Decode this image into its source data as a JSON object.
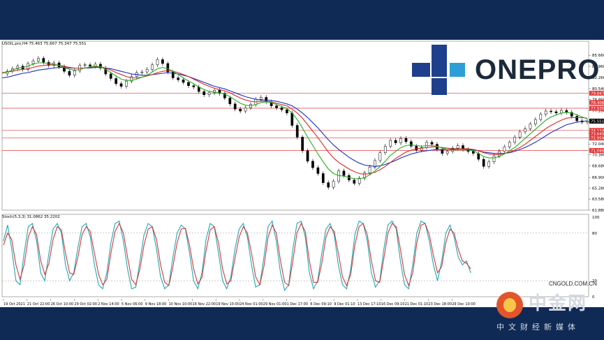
{
  "chart_data": [
    {
      "type": "line",
      "title": "USOIL.pro,H4 75.463 75.667 75.347 75.551",
      "ylim": [
        61.88,
        87.4
      ],
      "y_ticks": [
        "85.660",
        "83.960",
        "82.260",
        "80.540",
        "78.860",
        "77.160",
        "75.441",
        "73.740",
        "72.040",
        "70.380",
        "68.680",
        "66.900",
        "65.280",
        "63.580",
        "61.880"
      ],
      "price_labels": [
        {
          "text": "79.847",
          "value": 79.847,
          "color": "#e23b3b"
        },
        {
          "text": "78.406",
          "value": 78.406,
          "color": "#e23b3b"
        },
        {
          "text": "77.535",
          "value": 77.535,
          "color": "#e23b3b"
        },
        {
          "text": "75.551",
          "value": 75.551,
          "color": "#000000"
        },
        {
          "text": "74.124",
          "value": 74.124,
          "color": "#e23b3b"
        },
        {
          "text": "73.640",
          "value": 73.64,
          "color": "#e23b3b"
        },
        {
          "text": "72.959",
          "value": 72.959,
          "color": "#e23b3b"
        },
        {
          "text": "71.046",
          "value": 71.046,
          "color": "#e23b3b"
        }
      ],
      "h_lines": [
        79.847,
        77.535,
        74.124,
        72.959,
        71.046
      ],
      "x_labels": [
        "19 Oct 2021",
        "21 Oct 22:00",
        "26 Oct 10:00",
        "29 Oct 02:00",
        "2 Nov 14:00",
        "5 Nov 06:00",
        "9 Nov 18:00",
        "10 Nov 10:00",
        "16 Nov 22:00",
        "19 Nov 10:00",
        "24 Nov 01:00",
        "29 Nov 01:00",
        "1 Dec 17:00",
        "6 Dec 09:10",
        "9 Dec 01:10",
        "13 Dec 17:10",
        "16 Dec 09:10",
        "21 Dec 01:10",
        "23 Dec 18:00",
        "29 Dec 10:00"
      ],
      "close": [
        82.8,
        83.2,
        83.6,
        84.0,
        83.5,
        84.4,
        84.8,
        85.2,
        84.6,
        84.1,
        84.5,
        83.9,
        83.2,
        82.6,
        83.3,
        84.1,
        84.2,
        84.0,
        84.3,
        83.7,
        82.8,
        82.1,
        81.3,
        80.9,
        81.7,
        82.4,
        83.0,
        83.1,
        83.5,
        84.2,
        85.0,
        84.4,
        83.1,
        82.2,
        81.9,
        81.5,
        81.0,
        80.8,
        80.1,
        79.6,
        79.9,
        80.3,
        79.8,
        79.1,
        78.2,
        77.4,
        77.1,
        77.6,
        78.1,
        78.9,
        79.2,
        78.5,
        77.9,
        77.6,
        77.3,
        76.8,
        74.9,
        73.1,
        71.0,
        69.4,
        68.4,
        67.5,
        66.1,
        65.4,
        66.3,
        67.9,
        67.2,
        66.5,
        66.0,
        66.8,
        67.6,
        68.5,
        69.5,
        70.7,
        71.7,
        72.6,
        72.2,
        72.9,
        72.4,
        71.7,
        71.1,
        71.5,
        72.3,
        72.0,
        71.2,
        70.6,
        70.9,
        71.4,
        71.8,
        71.2,
        70.9,
        70.6,
        69.7,
        68.6,
        69.3,
        70.2,
        70.9,
        71.6,
        72.3,
        73.1,
        73.9,
        74.4,
        75.1,
        75.8,
        76.6,
        77.1,
        77.0,
        76.8,
        77.2,
        76.9,
        76.3,
        75.6,
        75.4,
        75.551
      ],
      "ma_green": [
        82.9,
        83.1,
        83.4,
        83.7,
        83.8,
        84.0,
        84.3,
        84.5,
        84.5,
        84.4,
        84.3,
        84.1,
        83.8,
        83.5,
        83.4,
        83.5,
        83.7,
        83.9,
        84.0,
        83.9,
        83.5,
        83.0,
        82.5,
        82.0,
        81.8,
        81.8,
        82.0,
        82.3,
        82.6,
        83.1,
        83.6,
        83.8,
        83.6,
        83.2,
        82.7,
        82.2,
        81.7,
        81.3,
        80.8,
        80.4,
        80.1,
        80.0,
        79.9,
        79.7,
        79.3,
        78.8,
        78.3,
        78.0,
        77.9,
        78.1,
        78.4,
        78.5,
        78.4,
        78.1,
        77.8,
        77.5,
        76.8,
        75.8,
        74.5,
        73.1,
        71.8,
        70.5,
        69.3,
        68.2,
        67.5,
        67.2,
        67.1,
        66.9,
        66.7,
        66.7,
        66.9,
        67.3,
        67.9,
        68.6,
        69.4,
        70.3,
        70.9,
        71.5,
        71.8,
        71.9,
        71.8,
        71.7,
        71.8,
        71.8,
        71.7,
        71.4,
        71.2,
        71.1,
        71.2,
        71.2,
        71.1,
        71.0,
        70.6,
        70.1,
        69.9,
        69.9,
        70.1,
        70.5,
        71.0,
        71.5,
        72.2,
        72.9,
        73.6,
        74.3,
        75.0,
        75.7,
        76.2,
        76.5,
        76.8,
        76.9,
        76.8,
        76.5,
        76.2,
        75.9
      ],
      "ma_red": [
        83.0,
        83.1,
        83.2,
        83.4,
        83.5,
        83.6,
        83.8,
        84.0,
        84.1,
        84.2,
        84.2,
        84.1,
        84.0,
        83.8,
        83.7,
        83.7,
        83.7,
        83.8,
        83.9,
        83.9,
        83.7,
        83.4,
        83.0,
        82.7,
        82.4,
        82.2,
        82.2,
        82.3,
        82.5,
        82.7,
        83.0,
        83.2,
        83.3,
        83.2,
        83.0,
        82.7,
        82.4,
        82.0,
        81.6,
        81.2,
        80.9,
        80.6,
        80.4,
        80.2,
        79.9,
        79.5,
        79.1,
        78.8,
        78.6,
        78.5,
        78.6,
        78.6,
        78.5,
        78.3,
        78.1,
        77.9,
        77.4,
        76.8,
        76.0,
        75.0,
        74.0,
        73.0,
        71.9,
        70.8,
        69.9,
        69.2,
        68.7,
        68.2,
        67.8,
        67.5,
        67.4,
        67.5,
        67.7,
        68.1,
        68.6,
        69.2,
        69.8,
        70.3,
        70.8,
        71.1,
        71.3,
        71.4,
        71.5,
        71.6,
        71.6,
        71.5,
        71.4,
        71.3,
        71.3,
        71.3,
        71.3,
        71.2,
        71.0,
        70.7,
        70.5,
        70.4,
        70.4,
        70.6,
        70.8,
        71.1,
        71.5,
        72.0,
        72.6,
        73.2,
        73.8,
        74.4,
        74.9,
        75.3,
        75.7,
        76.0,
        76.1,
        76.1,
        76.1,
        76.0
      ],
      "ma_blue": [
        82.2,
        82.3,
        82.5,
        82.7,
        82.9,
        83.0,
        83.2,
        83.4,
        83.5,
        83.6,
        83.7,
        83.8,
        83.8,
        83.7,
        83.7,
        83.7,
        83.7,
        83.7,
        83.8,
        83.8,
        83.7,
        83.6,
        83.4,
        83.2,
        83.0,
        82.8,
        82.7,
        82.6,
        82.6,
        82.7,
        82.8,
        82.9,
        83.0,
        82.9,
        82.8,
        82.6,
        82.4,
        82.1,
        81.8,
        81.5,
        81.2,
        80.9,
        80.7,
        80.5,
        80.2,
        79.9,
        79.6,
        79.3,
        79.1,
        78.9,
        78.8,
        78.8,
        78.7,
        78.6,
        78.4,
        78.2,
        77.9,
        77.4,
        76.8,
        76.1,
        75.3,
        74.5,
        73.6,
        72.7,
        71.9,
        71.2,
        70.6,
        70.0,
        69.5,
        69.1,
        68.8,
        68.7,
        68.6,
        68.7,
        68.9,
        69.2,
        69.5,
        69.9,
        70.2,
        70.5,
        70.7,
        70.9,
        71.0,
        71.1,
        71.2,
        71.2,
        71.2,
        71.2,
        71.2,
        71.2,
        71.2,
        71.1,
        71.0,
        70.8,
        70.7,
        70.6,
        70.6,
        70.6,
        70.7,
        70.9,
        71.2,
        71.5,
        71.9,
        72.3,
        72.8,
        73.3,
        73.8,
        74.2,
        74.6,
        75.0,
        75.2,
        75.4,
        75.5,
        75.6
      ]
    },
    {
      "type": "line",
      "title": "Stoch(5,3,3) 31.0862 35.2202",
      "ylim": [
        0,
        100
      ],
      "y_ticks": [
        "100",
        "80",
        "20",
        "0"
      ],
      "levels": [
        80,
        20
      ],
      "series": [
        {
          "color": "#22a7b3",
          "values": [
            70,
            90,
            60,
            20,
            15,
            55,
            88,
            92,
            70,
            30,
            20,
            55,
            85,
            92,
            80,
            40,
            20,
            30,
            62,
            88,
            92,
            75,
            40,
            15,
            10,
            30,
            68,
            92,
            95,
            70,
            35,
            10,
            12,
            45,
            78,
            92,
            88,
            60,
            25,
            10,
            15,
            50,
            80,
            90,
            85,
            55,
            20,
            10,
            30,
            72,
            92,
            88,
            55,
            20,
            10,
            25,
            60,
            85,
            92,
            75,
            40,
            12,
            15,
            50,
            88,
            95,
            70,
            30,
            8,
            15,
            60,
            92,
            95,
            75,
            30,
            10,
            20,
            55,
            85,
            92,
            78,
            40,
            15,
            10,
            35,
            78,
            95,
            92,
            70,
            30,
            12,
            20,
            60,
            90,
            95,
            85,
            45,
            15,
            10,
            40,
            80,
            95,
            92,
            70,
            40,
            20,
            45,
            80,
            90,
            75,
            50,
            40,
            45,
            30
          ]
        },
        {
          "color": "#d13b3b",
          "values": [
            65,
            80,
            72,
            40,
            22,
            40,
            75,
            88,
            78,
            45,
            28,
            42,
            72,
            88,
            84,
            55,
            30,
            28,
            50,
            78,
            88,
            82,
            55,
            28,
            15,
            22,
            55,
            82,
            92,
            80,
            50,
            22,
            15,
            35,
            65,
            85,
            88,
            72,
            40,
            18,
            14,
            38,
            68,
            85,
            86,
            65,
            35,
            16,
            24,
            58,
            84,
            88,
            68,
            35,
            16,
            20,
            48,
            75,
            88,
            80,
            55,
            25,
            15,
            38,
            75,
            90,
            80,
            45,
            18,
            14,
            45,
            80,
            92,
            82,
            45,
            18,
            18,
            42,
            75,
            88,
            82,
            55,
            25,
            14,
            28,
            65,
            88,
            92,
            78,
            45,
            20,
            18,
            48,
            80,
            92,
            88,
            60,
            28,
            14,
            30,
            68,
            90,
            92,
            78,
            52,
            30,
            38,
            68,
            85,
            80,
            60,
            45,
            42,
            35
          ]
        }
      ]
    }
  ],
  "logo": {
    "text": "ONEPRO"
  },
  "watermark": {
    "url": "CNGOLD.COM.CN",
    "name": "中金网",
    "subtitle": "中文财经新媒体"
  }
}
